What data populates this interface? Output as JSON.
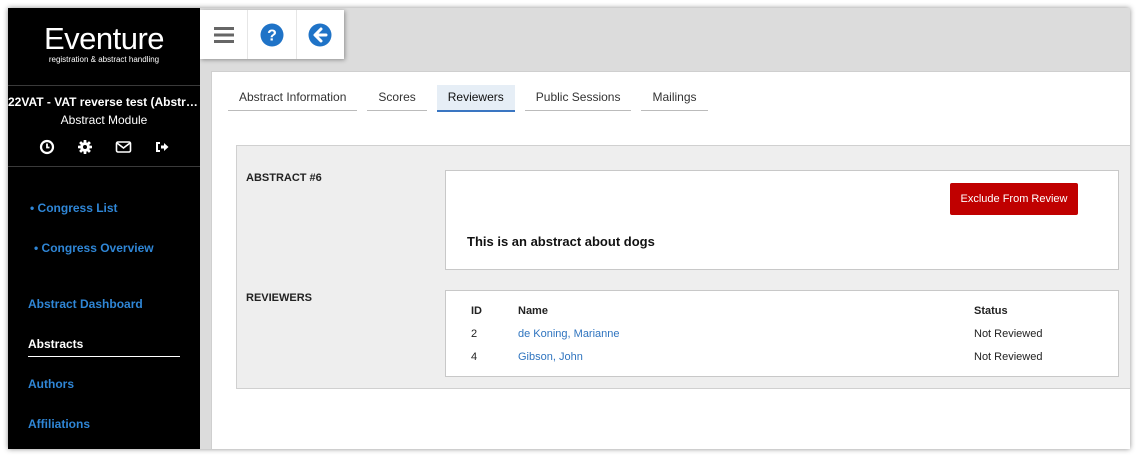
{
  "brand": {
    "name": "Eventure",
    "tagline": "registration & abstract handling"
  },
  "congress": {
    "title": "22VAT - VAT reverse test (Abstract...",
    "module": "Abstract Module"
  },
  "sidebar_icons": [
    "clock-icon",
    "gear-icon",
    "mail-icon",
    "logout-icon"
  ],
  "nav": {
    "congress_list": "• Congress List",
    "congress_overview": "• Congress Overview",
    "abstract_dashboard": "Abstract Dashboard",
    "abstracts": "Abstracts",
    "authors": "Authors",
    "affiliations": "Affiliations"
  },
  "toolbar_icons": [
    "menu-icon",
    "help-icon",
    "back-icon"
  ],
  "tabs": [
    "Abstract Information",
    "Scores",
    "Reviewers",
    "Public Sessions",
    "Mailings"
  ],
  "active_tab": "Reviewers",
  "abstract": {
    "label": "ABSTRACT #6",
    "exclude_label": "Exclude From Review",
    "text": "This is an abstract about dogs"
  },
  "reviewers": {
    "label": "REVIEWERS",
    "columns": {
      "id": "ID",
      "name": "Name",
      "status": "Status"
    },
    "rows": [
      {
        "id": "2",
        "name": "de Koning, Marianne",
        "status": "Not Reviewed"
      },
      {
        "id": "4",
        "name": "Gibson, John",
        "status": "Not Reviewed"
      }
    ]
  },
  "colors": {
    "sidebar": "#000000",
    "link": "#2f86d6",
    "danger": "#c00000",
    "icon_blue": "#1f73c7"
  }
}
